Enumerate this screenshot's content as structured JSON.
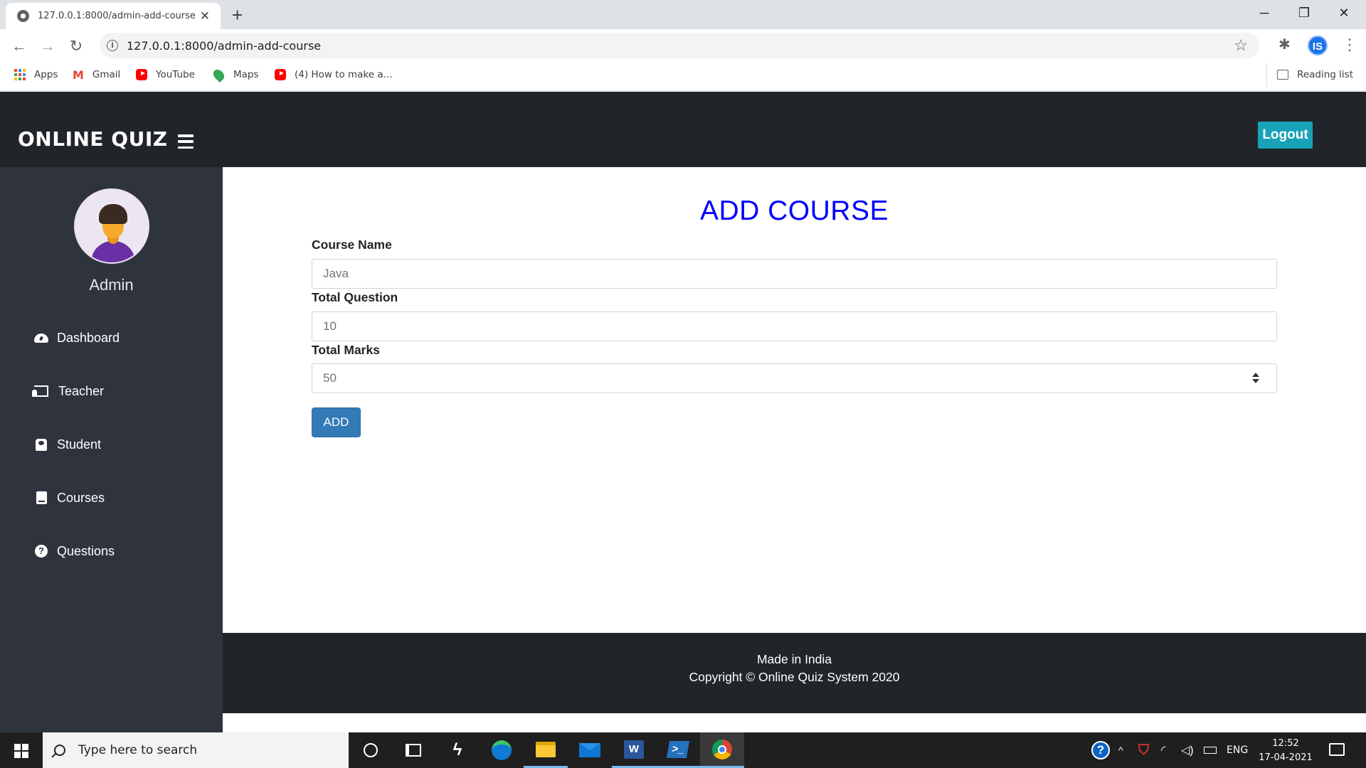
{
  "browser": {
    "tab_title": "127.0.0.1:8000/admin-add-course",
    "url": "127.0.0.1:8000/admin-add-course",
    "bookmarks": [
      {
        "label": "Apps",
        "icon": "apps-grid-icon"
      },
      {
        "label": "Gmail",
        "icon": "gmail-icon"
      },
      {
        "label": "YouTube",
        "icon": "youtube-icon"
      },
      {
        "label": "Maps",
        "icon": "maps-icon"
      },
      {
        "label": "(4) How to make a...",
        "icon": "youtube-icon"
      }
    ],
    "reading_list": "Reading list",
    "profile_initials": "IS"
  },
  "header": {
    "brand": "ONLINE QUIZ",
    "logout_label": "Logout",
    "background": "#212529",
    "logout_color": "#17a2b8"
  },
  "sidebar": {
    "user_name": "Admin",
    "background": "#2f333e",
    "items": [
      {
        "label": "Dashboard",
        "icon": "dashboard-icon"
      },
      {
        "label": "Teacher",
        "icon": "teacher-icon"
      },
      {
        "label": "Student",
        "icon": "student-icon"
      },
      {
        "label": "Courses",
        "icon": "book-icon"
      },
      {
        "label": "Questions",
        "icon": "question-circle-icon"
      }
    ]
  },
  "form": {
    "title": "ADD COURSE",
    "title_color": "#0000ff",
    "fields": [
      {
        "label": "Course Name",
        "value": "Java"
      },
      {
        "label": "Total Question",
        "value": "10"
      },
      {
        "label": "Total Marks",
        "value": "50"
      }
    ],
    "submit_label": "ADD",
    "submit_color": "#337ab7"
  },
  "footer": {
    "line1": "Made in India",
    "line2": "Copyright © Online Quiz System 2020"
  },
  "taskbar": {
    "search_placeholder": "Type here to search",
    "language": "ENG",
    "time": "12:52",
    "date": "17-04-2021"
  }
}
